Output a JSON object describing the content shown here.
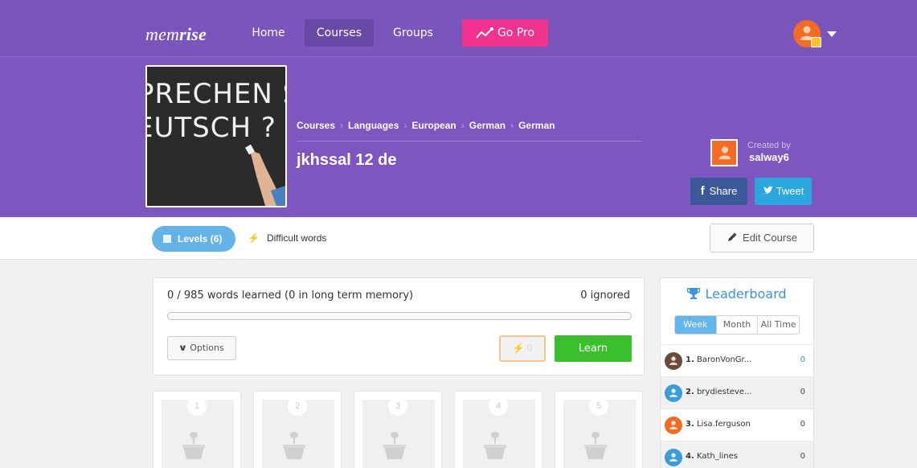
{
  "nav": {
    "logo_light": "mem",
    "logo_bold": "rise",
    "home": "Home",
    "courses": "Courses",
    "groups": "Groups",
    "gopro": "Go Pro",
    "colors": {
      "bar": "#7a55bc",
      "active": "#684aa6",
      "gopro": "#f0338f",
      "avatar": "#f46b24"
    }
  },
  "course": {
    "image_text_line1": "PRECHEN SI",
    "image_text_line2": "EUTSCH ?",
    "breadcrumb": [
      "Courses",
      "Languages",
      "European",
      "German",
      "German"
    ],
    "title": "jkhssal 12 de",
    "created_by_label": "Created by",
    "creator": "salway6",
    "share_label": "Share",
    "tweet_label": "Tweet"
  },
  "tabs": {
    "levels": "Levels (6)",
    "difficult": "Difficult words",
    "edit_course": "Edit Course"
  },
  "progress": {
    "words_learned": "0 / 985 words learned (0 in long term memory)",
    "ignored": "0 ignored",
    "fraction": 0,
    "options_label": "Options",
    "difficult_count": "0",
    "learn_label": "Learn"
  },
  "levels": [
    {
      "number": "1"
    },
    {
      "number": "2"
    },
    {
      "number": "3"
    },
    {
      "number": "4"
    },
    {
      "number": "5"
    }
  ],
  "leaderboard": {
    "title": "Leaderboard",
    "tabs": [
      "Week",
      "Month",
      "All Time"
    ],
    "rows": [
      {
        "rank": "1.",
        "name": "BaronVonGr...",
        "score": "0",
        "avatar_color": "#6b4a3a"
      },
      {
        "rank": "2.",
        "name": "brydiesteve...",
        "score": "0",
        "avatar_color": "#3d9dd8"
      },
      {
        "rank": "3.",
        "name": "Lisa.ferguson",
        "score": "0",
        "avatar_color": "#f46b24"
      },
      {
        "rank": "4.",
        "name": "Kath_lines",
        "score": "0",
        "avatar_color": "#3d9dd8"
      }
    ]
  }
}
